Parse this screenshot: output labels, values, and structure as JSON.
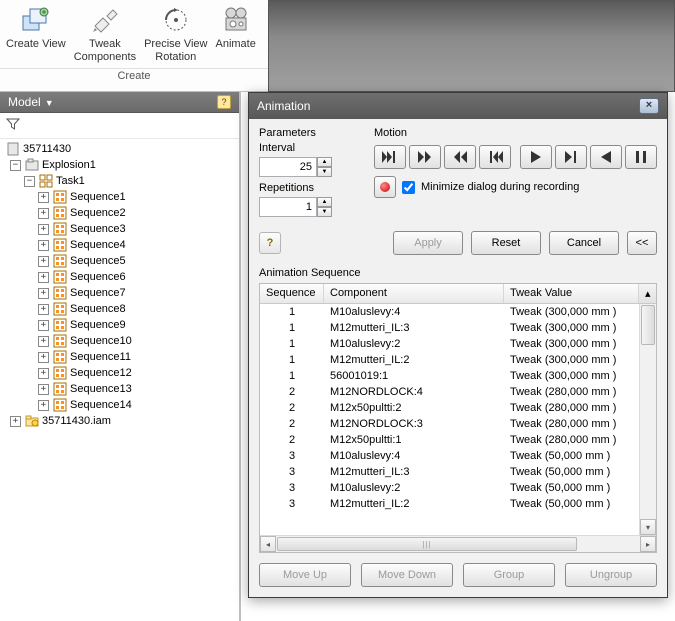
{
  "ribbon": {
    "group_label": "Create",
    "buttons": [
      {
        "label": "Create View"
      },
      {
        "label": "Tweak\nComponents"
      },
      {
        "label": "Precise View\nRotation"
      },
      {
        "label": "Animate"
      }
    ]
  },
  "panel": {
    "title": "Model",
    "root": "35711430",
    "explosion": "Explosion1",
    "task": "Task1",
    "sequences": [
      "Sequence1",
      "Sequence2",
      "Sequence3",
      "Sequence4",
      "Sequence5",
      "Sequence6",
      "Sequence7",
      "Sequence8",
      "Sequence9",
      "Sequence10",
      "Sequence11",
      "Sequence12",
      "Sequence13",
      "Sequence14"
    ],
    "iam": "35711430.iam"
  },
  "dialog": {
    "title": "Animation",
    "parameters_label": "Parameters",
    "interval_label": "Interval",
    "interval_value": "25",
    "repetitions_label": "Repetitions",
    "repetitions_value": "1",
    "motion_label": "Motion",
    "minimize_label": "Minimize dialog during recording",
    "minimize_checked": true,
    "apply_label": "Apply",
    "reset_label": "Reset",
    "cancel_label": "Cancel",
    "collapse_label": "<<",
    "sequence_header": "Animation Sequence",
    "columns": {
      "seq": "Sequence",
      "comp": "Component",
      "tw": "Tweak Value"
    },
    "rows": [
      {
        "s": "1",
        "c": "M10aluslevy:4",
        "t": "Tweak (300,000 mm )"
      },
      {
        "s": "1",
        "c": "M12mutteri_IL:3",
        "t": "Tweak (300,000 mm )"
      },
      {
        "s": "1",
        "c": "M10aluslevy:2",
        "t": "Tweak (300,000 mm )"
      },
      {
        "s": "1",
        "c": "M12mutteri_IL:2",
        "t": "Tweak (300,000 mm )"
      },
      {
        "s": "1",
        "c": "56001019:1",
        "t": "Tweak (300,000 mm )"
      },
      {
        "s": "2",
        "c": "M12NORDLOCK:4",
        "t": "Tweak (280,000 mm )"
      },
      {
        "s": "2",
        "c": "M12x50pultti:2",
        "t": "Tweak (280,000 mm )"
      },
      {
        "s": "2",
        "c": "M12NORDLOCK:3",
        "t": "Tweak (280,000 mm )"
      },
      {
        "s": "2",
        "c": "M12x50pultti:1",
        "t": "Tweak (280,000 mm )"
      },
      {
        "s": "3",
        "c": "M10aluslevy:4",
        "t": "Tweak (50,000 mm )"
      },
      {
        "s": "3",
        "c": "M12mutteri_IL:3",
        "t": "Tweak (50,000 mm )"
      },
      {
        "s": "3",
        "c": "M10aluslevy:2",
        "t": "Tweak (50,000 mm )"
      },
      {
        "s": "3",
        "c": "M12mutteri_IL:2",
        "t": "Tweak (50,000 mm )"
      }
    ],
    "moveup": "Move Up",
    "movedown": "Move Down",
    "group": "Group",
    "ungroup": "Ungroup"
  }
}
